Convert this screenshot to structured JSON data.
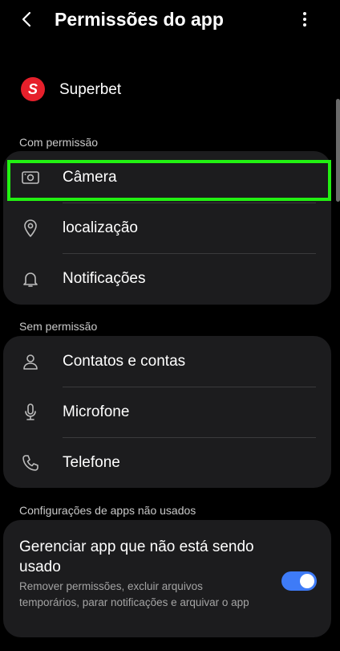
{
  "header": {
    "title": "Permissões do app",
    "back_icon": "chevron-left-icon",
    "more_icon": "more-vertical-icon"
  },
  "app": {
    "name": "Superbet",
    "logo_letter": "S",
    "logo_color": "#e6202b"
  },
  "granted": {
    "label": "Com permissão",
    "items": [
      {
        "label": "Câmera",
        "icon": "camera-icon"
      },
      {
        "label": "localização",
        "icon": "location-pin-icon"
      },
      {
        "label": "Notificações",
        "icon": "bell-icon"
      }
    ]
  },
  "denied": {
    "label": "Sem permissão",
    "items": [
      {
        "label": "Contatos e contas",
        "icon": "person-icon"
      },
      {
        "label": "Microfone",
        "icon": "microphone-icon"
      },
      {
        "label": "Telefone",
        "icon": "phone-icon"
      }
    ]
  },
  "unused": {
    "section_label": "Configurações de apps não usados",
    "title": "Gerenciar app que não está sendo usado",
    "description": "Remover permissões, excluir arquivos temporários, parar notificações e arquivar o app",
    "toggle_on": true
  },
  "colors": {
    "background": "#000000",
    "card": "#1c1c1e",
    "accent": "#3e7bf7",
    "highlight": "#22f012"
  }
}
